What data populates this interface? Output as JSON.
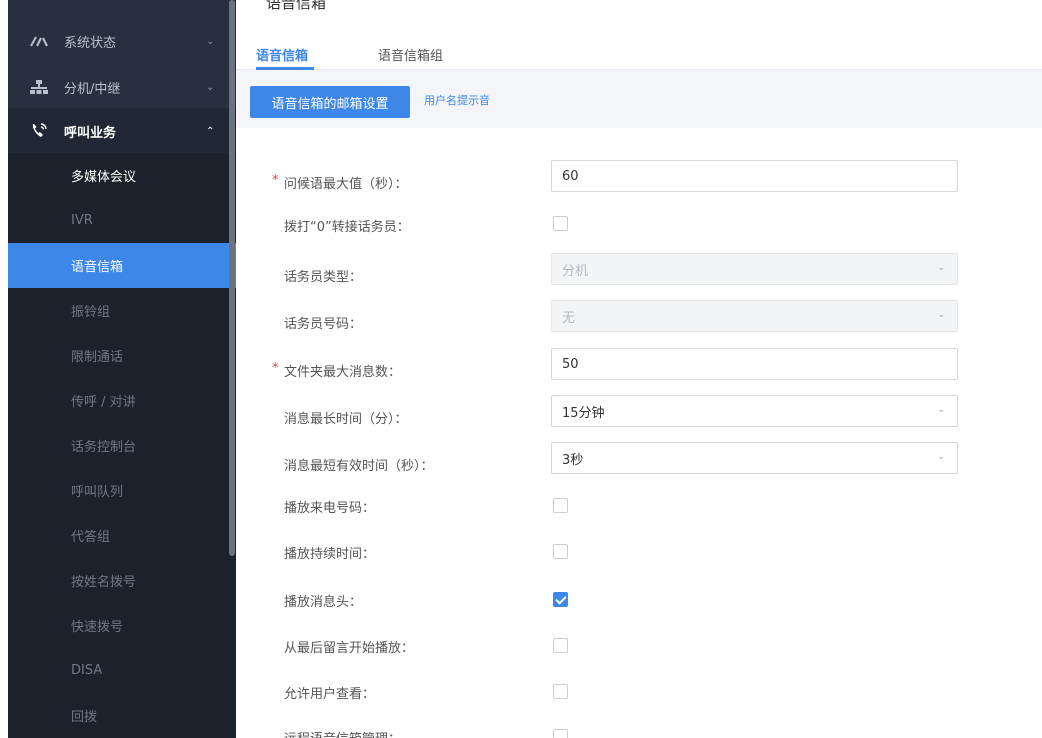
{
  "sidebar": {
    "groups": [
      {
        "label": "系统状态",
        "icon": "gauge-icon"
      },
      {
        "label": "分机/中继",
        "icon": "network-icon"
      },
      {
        "label": "呼叫业务",
        "icon": "phone-call-icon"
      }
    ],
    "items": [
      {
        "label": "多媒体会议"
      },
      {
        "label": "IVR"
      },
      {
        "label": "语音信箱"
      },
      {
        "label": "振铃组"
      },
      {
        "label": "限制通话"
      },
      {
        "label": "传呼 / 对讲"
      },
      {
        "label": "话务控制台"
      },
      {
        "label": "呼叫队列"
      },
      {
        "label": "代答组"
      },
      {
        "label": "按姓名拨号"
      },
      {
        "label": "快速拨号"
      },
      {
        "label": "DISA"
      },
      {
        "label": "回拨"
      }
    ],
    "active_item": "语音信箱"
  },
  "main": {
    "page_title": "语音信箱",
    "tabs": [
      {
        "label": "语音信箱",
        "active": true
      },
      {
        "label": "语音信箱组",
        "active": false
      }
    ],
    "subtabs": [
      {
        "label": "语音信箱的邮箱设置",
        "active": true
      },
      {
        "label": "用户名提示音",
        "active": false
      }
    ]
  },
  "form": {
    "required_mark": "*",
    "fields": [
      {
        "label": "问候语最大值（秒）：",
        "required": true,
        "type": "text",
        "value": "60"
      },
      {
        "label": "拨打“0”转接话务员：",
        "type": "checkbox",
        "checked": false
      },
      {
        "label": "话务员类型：",
        "type": "select",
        "value": "分机",
        "disabled": true
      },
      {
        "label": "话务员号码：",
        "type": "select",
        "value": "无",
        "disabled": true
      },
      {
        "label": "文件夹最大消息数：",
        "required": true,
        "type": "text",
        "value": "50"
      },
      {
        "label": "消息最长时间（分）：",
        "type": "select",
        "value": "15分钟"
      },
      {
        "label": "消息最短有效时间（秒）：",
        "type": "select",
        "value": "3秒"
      },
      {
        "label": "播放来电号码：",
        "type": "checkbox",
        "checked": false
      },
      {
        "label": "播放持续时间：",
        "type": "checkbox",
        "checked": false
      },
      {
        "label": "播放消息头：",
        "type": "checkbox",
        "checked": true
      },
      {
        "label": "从最后留言开始播放：",
        "type": "checkbox",
        "checked": false
      },
      {
        "label": "允许用户查看：",
        "type": "checkbox",
        "checked": false
      },
      {
        "label": "远程语音信箱管理：",
        "type": "checkbox",
        "checked": false
      }
    ]
  },
  "colors": {
    "sidebar_bg": "#27303f",
    "submenu_bg": "#1c222c",
    "accent": "#3d87e8",
    "required": "#e5483d"
  }
}
